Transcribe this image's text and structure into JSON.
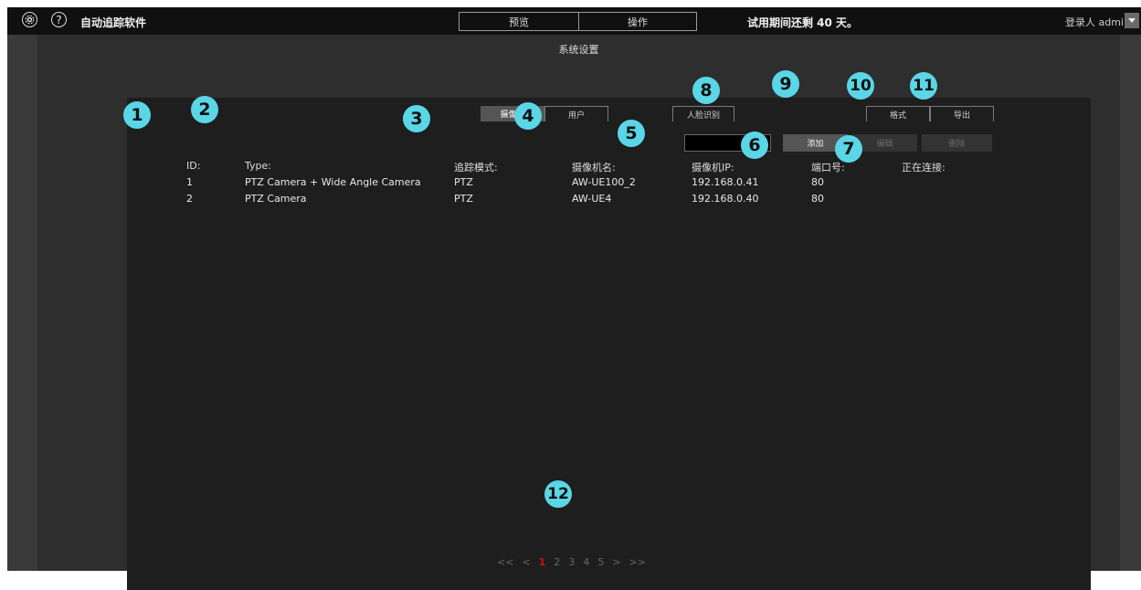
{
  "topbar": {
    "title": "自动追踪软件",
    "settings_icon": "gear-icon",
    "help_icon": "help-icon",
    "help_glyph": "?",
    "tabs": [
      {
        "label": "预览"
      },
      {
        "label": "操作"
      }
    ],
    "trial": "试用期间还剩 40 天。",
    "login_user": "登录人 admin"
  },
  "page_title": "系统设置",
  "sub_tabs": {
    "camera": "摄像机",
    "user": "用户",
    "face": "人脸识别",
    "format": "格式",
    "export": "导出"
  },
  "actions": {
    "search_value": "",
    "add": "添加",
    "edit": "编辑",
    "delete": "删除"
  },
  "table": {
    "headers": {
      "id": "ID:",
      "type": "Type:",
      "mode": "追踪模式:",
      "name": "摄像机名:",
      "ip": "摄像机IP:",
      "port": "端口号:",
      "connected": "正在连接:"
    },
    "rows": [
      {
        "id": "1",
        "type": "PTZ Camera + Wide Angle Camera",
        "mode": "PTZ",
        "name": "AW-UE100_2",
        "ip": "192.168.0.41",
        "port": "80"
      },
      {
        "id": "2",
        "type": "PTZ Camera",
        "mode": "PTZ",
        "name": "AW-UE4",
        "ip": "192.168.0.40",
        "port": "80"
      }
    ]
  },
  "pagination": {
    "first": "<<",
    "prev": "<",
    "pages": [
      "1",
      "2",
      "3",
      "4",
      "5"
    ],
    "current": "1",
    "next": ">",
    "last": ">>"
  },
  "callouts": [
    "1",
    "2",
    "3",
    "4",
    "5",
    "6",
    "7",
    "8",
    "9",
    "10",
    "11",
    "12"
  ],
  "colors": {
    "callout": "#5ad6e6",
    "current_page": "#d01010"
  }
}
